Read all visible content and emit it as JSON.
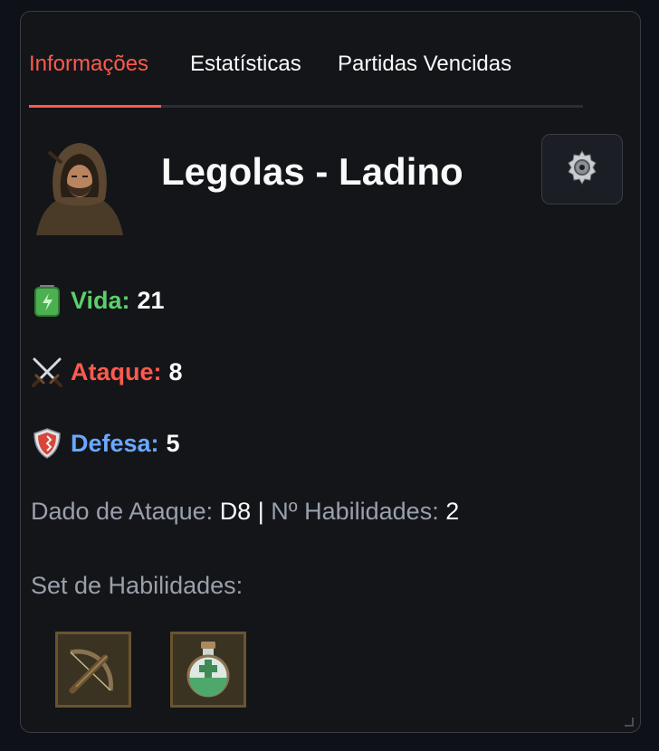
{
  "tabs": [
    {
      "label": "Informações",
      "active": true
    },
    {
      "label": "Estatísticas",
      "active": false
    },
    {
      "label": "Partidas Vencidas",
      "active": false
    }
  ],
  "hero": {
    "name": "Legolas - Ladino",
    "avatar_icon": "hooded-rogue-portrait"
  },
  "settings": {
    "icon": "gear-icon"
  },
  "stats": {
    "vida": {
      "label": "Vida:",
      "value": "21",
      "color": "#5ccf6b",
      "icon": "battery-icon"
    },
    "ataque": {
      "label": "Ataque:",
      "value": "8",
      "color": "#ff5a4d",
      "icon": "crossed-swords-icon"
    },
    "defesa": {
      "label": "Defesa:",
      "value": "5",
      "color": "#6aa8ff",
      "icon": "shield-icon"
    }
  },
  "details": {
    "dado_label": "Dado de Ataque:",
    "dado_value": "D8",
    "separator": "|",
    "habilidades_label": "Nº Habilidades:",
    "habilidades_value": "2"
  },
  "skills": {
    "heading": "Set de Habilidades:",
    "items": [
      {
        "icon": "crossbow-icon"
      },
      {
        "icon": "healing-potion-icon"
      }
    ]
  },
  "colors": {
    "accent": "#ff5a4d",
    "background": "#0e1117",
    "card": "#131519",
    "muted_text": "#9aa0ab"
  }
}
